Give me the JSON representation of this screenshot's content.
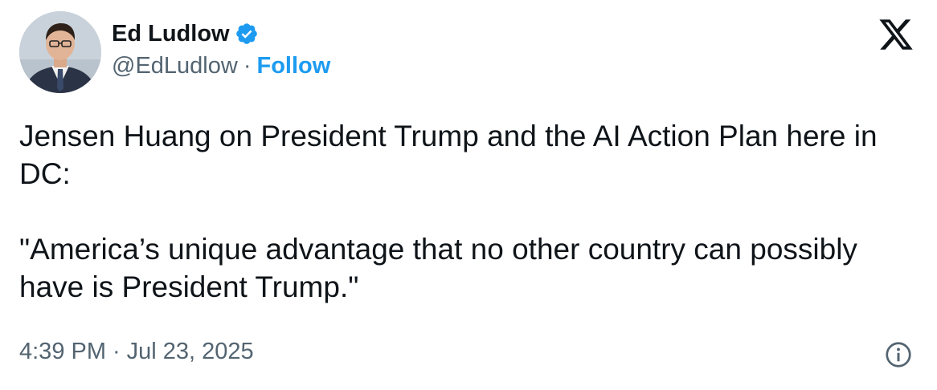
{
  "author": {
    "display_name": "Ed Ludlow",
    "handle": "@EdLudlow",
    "separator": "·",
    "follow_label": "Follow"
  },
  "tweet": {
    "paragraphs": [
      "Jensen Huang on President Trump and the AI Action Plan here in DC:",
      "\"America’s unique advantage that no other country can possibly have is President Trump.\""
    ]
  },
  "footer": {
    "time": "4:39 PM",
    "separator": "·",
    "date": "Jul 23, 2025"
  },
  "icons": {
    "verified": "verified-badge-icon",
    "logo": "x-logo-icon",
    "info": "info-icon"
  },
  "colors": {
    "text": "#0f1419",
    "secondary": "#536471",
    "accent": "#1d9bf0"
  }
}
